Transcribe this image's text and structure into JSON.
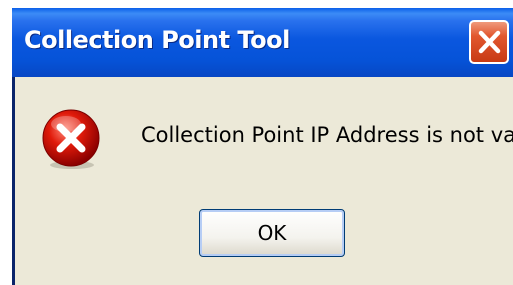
{
  "window": {
    "title": "Collection Point Tool",
    "close_icon": "close-icon"
  },
  "dialog": {
    "icon": "error-icon",
    "message": "Collection Point IP Address is not valid",
    "ok_label": "OK"
  },
  "colors": {
    "titlebar": "#0a57df",
    "client": "#ece9d8",
    "close_button": "#e2572f",
    "error_icon": "#d40000"
  }
}
